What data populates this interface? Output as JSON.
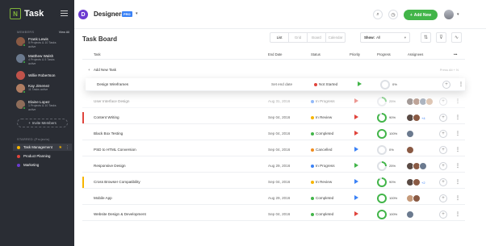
{
  "sidebar": {
    "brand": "Task",
    "brand_logo": "N",
    "members_label": "MEMBERS",
    "view_all": "View All",
    "members": [
      {
        "name": "Frank Lewis",
        "line1": "5 Projects & 10 Tasks",
        "line2": "active",
        "color": "#8a5a44"
      },
      {
        "name": "Matthew Walsh",
        "line1": "4 Projects & 5 Tasks",
        "line2": "active",
        "color": "#6b7a8f"
      },
      {
        "name": "Willie Robertson",
        "line1": "",
        "line2": "",
        "color": "#c0524a"
      },
      {
        "name": "Kay Jimenez",
        "line1": "11 Tasks active",
        "line2": "",
        "color": "#b07d62"
      },
      {
        "name": "Elaine Lopez",
        "line1": "1 Projects & 10 Tasks",
        "line2": "active",
        "color": "#8e6d5a"
      }
    ],
    "invite_label": "Invite Members",
    "starred_label": "STARRED (Projects)",
    "starred": [
      {
        "label": "Task Management",
        "color": "#f7b500"
      },
      {
        "label": "Product Planning",
        "color": "#e0443c"
      },
      {
        "label": "Marketing",
        "color": "#6c3bd1"
      }
    ]
  },
  "topbar": {
    "project_initial": "D",
    "project_name": "Designers",
    "badge": "PRO",
    "add_new": "Add New"
  },
  "board": {
    "title": "Task Board",
    "views": [
      "List",
      "Grid",
      "Board",
      "Calendar"
    ],
    "active_view": "List",
    "show_label": "Show:",
    "show_value": "All"
  },
  "columns": [
    "Task",
    "End Date",
    "Status",
    "Priority",
    "Progress",
    "Assignees"
  ],
  "add_task": "Add New Task",
  "add_task_hint": "Press Alt + N",
  "tasks": [
    {
      "name": "Design Wireframes",
      "date": "Set end date",
      "status": "Not Started",
      "status_color": "#e0443c",
      "priority": "#42b549",
      "progress": 0,
      "pct": "0%",
      "assignees": [],
      "more": "",
      "bar": "",
      "hl": true
    },
    {
      "name": "User Interface Design",
      "date": "Aug 31, 2016",
      "status": "In Progress",
      "status_color": "#3b82f6",
      "priority": "#e0443c",
      "progress": 25,
      "pct": "25%",
      "assignees": [
        "#5a4a44",
        "#8a5a44",
        "#6b7a8f",
        "#c69a7a"
      ],
      "more": "",
      "bar": "",
      "dim": true
    },
    {
      "name": "Content Writing",
      "date": "Sep 04, 2016",
      "status": "In Review",
      "status_color": "#f7b500",
      "priority": "#e0443c",
      "progress": 90,
      "pct": "90%",
      "assignees": [
        "#5a4a44",
        "#8a5a44"
      ],
      "more": "+4",
      "bar": "#e0443c"
    },
    {
      "name": "Black Box Testing",
      "date": "Sep 04, 2016",
      "status": "Completed",
      "status_color": "#42b549",
      "priority": "#e0443c",
      "progress": 100,
      "pct": "100%",
      "assignees": [
        "#6b7a8f"
      ],
      "more": "",
      "bar": ""
    },
    {
      "name": "PSD to HTML Conversion",
      "date": "Sep 04, 2016",
      "status": "Cancelled",
      "status_color": "#f08c1e",
      "priority": "#3b82f6",
      "progress": 0,
      "pct": "0%",
      "assignees": [
        "#8a5a44"
      ],
      "more": "",
      "bar": ""
    },
    {
      "name": "Responsive Design",
      "date": "Aug 29, 2016",
      "status": "In Progress",
      "status_color": "#3b82f6",
      "priority": "#42b549",
      "progress": 25,
      "pct": "25%",
      "assignees": [
        "#5a4a44",
        "#8a5a44",
        "#6b7a8f"
      ],
      "more": "",
      "bar": ""
    },
    {
      "name": "Cross Browser Compatibility",
      "date": "Sep 04, 2016",
      "status": "In Review",
      "status_color": "#f7b500",
      "priority": "#3b82f6",
      "progress": 90,
      "pct": "90%",
      "assignees": [
        "#5a4a44",
        "#8a5a44"
      ],
      "more": "+2",
      "bar": "#f7b500"
    },
    {
      "name": "Mobile App",
      "date": "Aug 29, 2016",
      "status": "Completed",
      "status_color": "#42b549",
      "priority": "#3b82f6",
      "progress": 100,
      "pct": "100%",
      "assignees": [
        "#c69a7a",
        "#8a5a44"
      ],
      "more": "",
      "bar": ""
    },
    {
      "name": "Website Design & Development",
      "date": "Sep 04, 2016",
      "status": "Completed",
      "status_color": "#42b549",
      "priority": "#e0443c",
      "progress": 100,
      "pct": "100%",
      "assignees": [
        "#6b7a8f"
      ],
      "more": "",
      "bar": ""
    }
  ]
}
